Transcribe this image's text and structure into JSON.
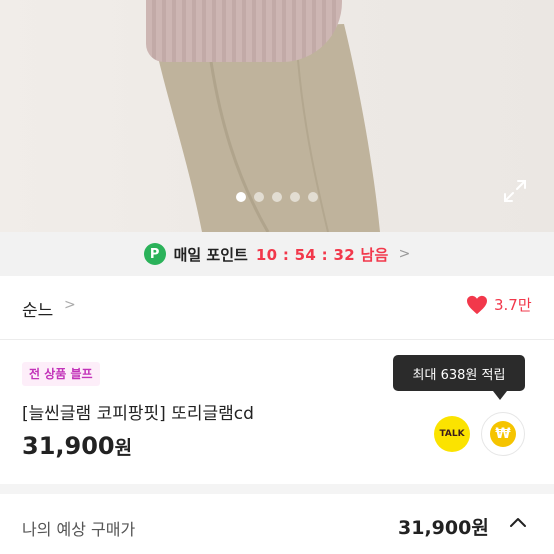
{
  "photo": {
    "slide_count": 5,
    "active_slide": 1
  },
  "points_banner": {
    "badge": "P",
    "label": "매일 포인트",
    "timer": "10 : 54 : 32 남음"
  },
  "brand": {
    "name": "순느",
    "likes": "3.7만"
  },
  "product": {
    "tag": "전 상품 블프",
    "title": "[늘씬글램 코피팡핏] 또리글램cd",
    "price": "31,900",
    "price_unit": "원",
    "reward_tooltip": "최대 638원 적립",
    "talk_label": "TALK",
    "won_symbol": "₩"
  },
  "expected_price": {
    "label": "나의 예상 구매가",
    "amount": "31,900원"
  },
  "colors": {
    "accent_red": "#f2384b",
    "points_green": "#2bb25a",
    "tag_pink": "#c233b9",
    "kakao_yellow": "#fbe300"
  }
}
